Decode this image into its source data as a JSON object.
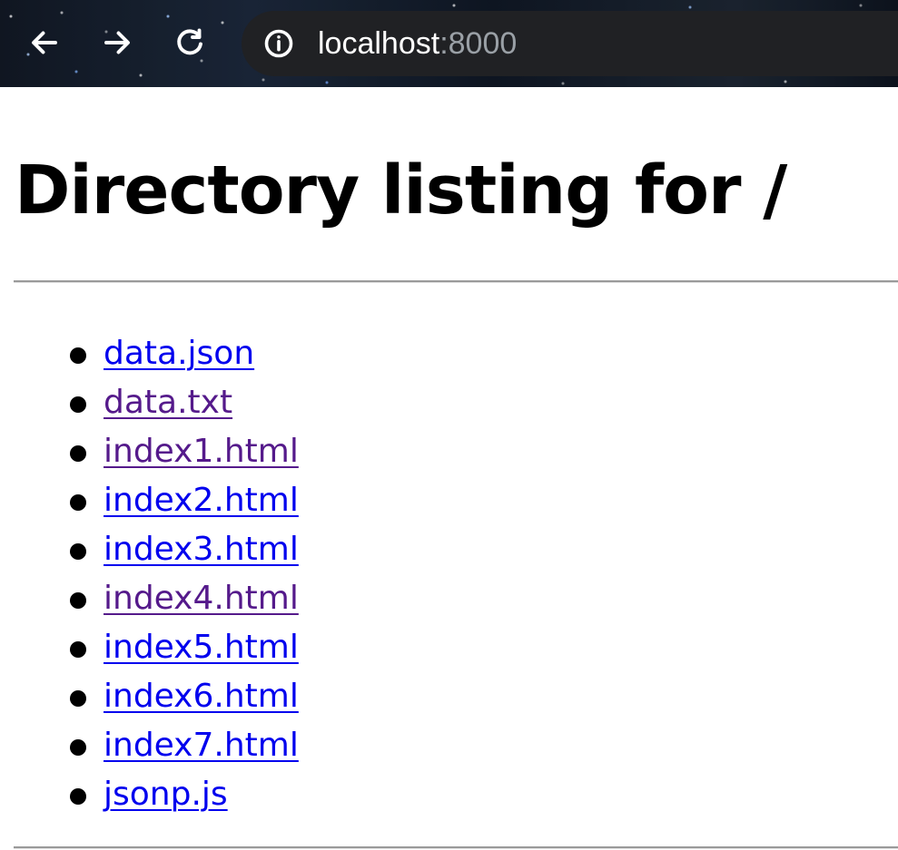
{
  "browser": {
    "url_host": "localhost",
    "url_port": ":8000",
    "icons": {
      "back": "back-arrow-icon",
      "forward": "forward-arrow-icon",
      "reload": "reload-icon",
      "site_info": "info-icon"
    }
  },
  "page": {
    "title": "Directory listing for /",
    "files": [
      {
        "name": "data.json",
        "visited": false
      },
      {
        "name": "data.txt",
        "visited": true
      },
      {
        "name": "index1.html",
        "visited": true
      },
      {
        "name": "index2.html",
        "visited": false
      },
      {
        "name": "index3.html",
        "visited": false
      },
      {
        "name": "index4.html",
        "visited": true
      },
      {
        "name": "index5.html",
        "visited": false
      },
      {
        "name": "index6.html",
        "visited": false
      },
      {
        "name": "index7.html",
        "visited": false
      },
      {
        "name": "jsonp.js",
        "visited": false
      }
    ]
  },
  "colors": {
    "link": "#0000ee",
    "visited_link": "#551a8b",
    "address_bar": "#202124",
    "port_text": "#9aa0a6"
  }
}
